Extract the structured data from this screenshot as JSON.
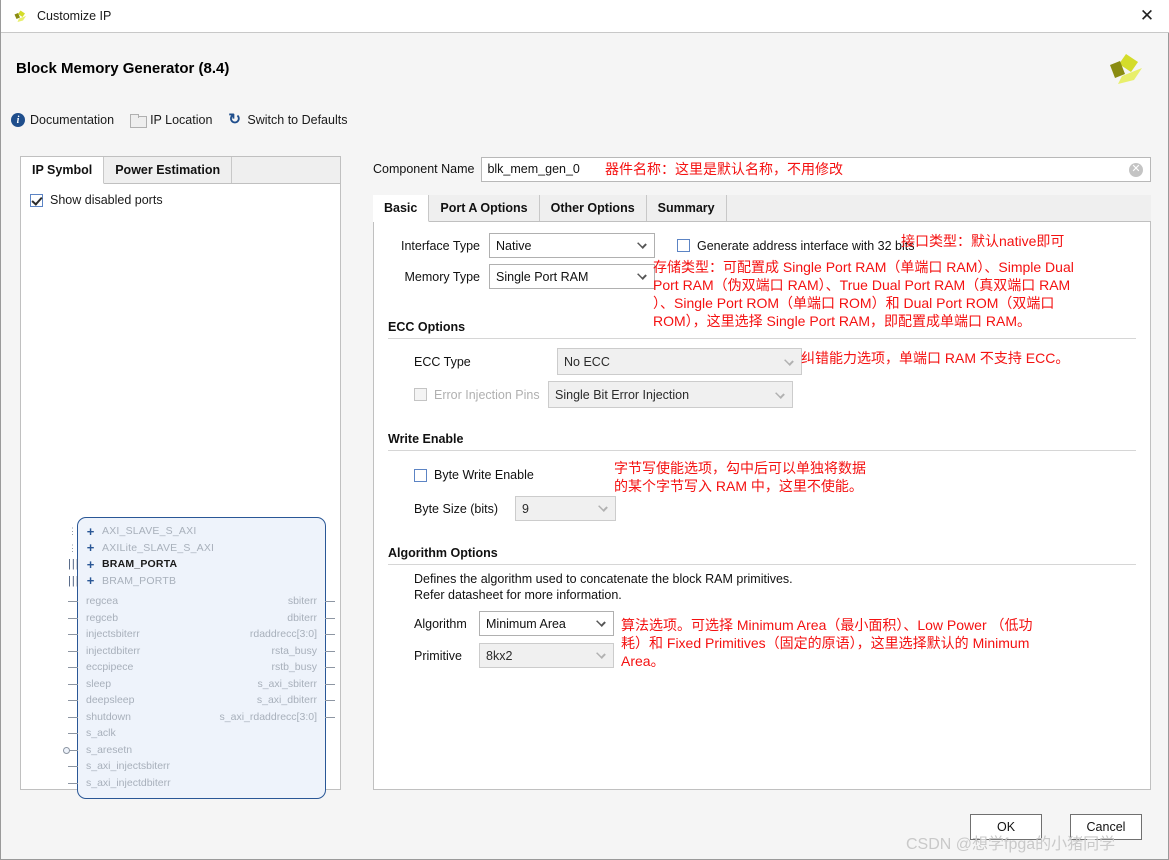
{
  "window": {
    "title": "Customize IP",
    "close_label": "✕",
    "logo_icon": "xilinx-logo"
  },
  "header": {
    "title": "Block Memory Generator (8.4)"
  },
  "toolbar": {
    "items": [
      {
        "label": "Documentation",
        "icon": "info-icon"
      },
      {
        "label": "IP Location",
        "icon": "folder-icon"
      },
      {
        "label": "Switch to Defaults",
        "icon": "refresh-icon"
      }
    ]
  },
  "left_panel": {
    "tabs": [
      {
        "label": "IP Symbol",
        "active": true
      },
      {
        "label": "Power Estimation",
        "active": false
      }
    ],
    "show_disabled_ports": {
      "label": "Show disabled ports",
      "checked": true
    },
    "symbol": {
      "buses": [
        {
          "label": "AXI_SLAVE_S_AXI",
          "enabled": false,
          "stub": "dotted"
        },
        {
          "label": "AXILite_SLAVE_S_AXI",
          "enabled": false,
          "stub": "dotted"
        },
        {
          "label": "BRAM_PORTA",
          "enabled": true,
          "stub": "solid"
        },
        {
          "label": "BRAM_PORTB",
          "enabled": false,
          "stub": "solid"
        }
      ],
      "pins": [
        {
          "left": "regcea",
          "right": "sbiterr"
        },
        {
          "left": "regceb",
          "right": "dbiterr"
        },
        {
          "left": "injectsbiterr",
          "right": "rdaddrecc[3:0]"
        },
        {
          "left": "injectdbiterr",
          "right": "rsta_busy"
        },
        {
          "left": "eccpipece",
          "right": "rstb_busy"
        },
        {
          "left": "sleep",
          "right": "s_axi_sbiterr"
        },
        {
          "left": "deepsleep",
          "right": "s_axi_dbiterr"
        },
        {
          "left": "shutdown",
          "right": "s_axi_rdaddrecc[3:0]"
        },
        {
          "left": "s_aclk",
          "right": ""
        },
        {
          "left": "s_aresetn",
          "right": ""
        },
        {
          "left": "s_axi_injectsbiterr",
          "right": ""
        },
        {
          "left": "s_axi_injectdbiterr",
          "right": ""
        }
      ]
    }
  },
  "right_panel": {
    "component_name": {
      "label": "Component Name",
      "value": "blk_mem_gen_0",
      "clear_icon": "clear-icon"
    },
    "tabs": [
      {
        "label": "Basic",
        "active": true
      },
      {
        "label": "Port A Options",
        "active": false
      },
      {
        "label": "Other Options",
        "active": false
      },
      {
        "label": "Summary",
        "active": false
      }
    ],
    "basic": {
      "interface_type": {
        "label": "Interface Type",
        "value": "Native"
      },
      "memory_type": {
        "label": "Memory Type",
        "value": "Single Port RAM"
      },
      "generate_address_interface": {
        "label": "Generate address interface with 32 bits",
        "checked": false
      },
      "ecc_options": {
        "title": "ECC Options",
        "ecc_type": {
          "label": "ECC Type",
          "value": "No ECC",
          "disabled": true
        },
        "error_injection_pins": {
          "label": "Error Injection Pins",
          "checked": false,
          "disabled": true,
          "value": "Single Bit Error Injection"
        }
      },
      "write_enable": {
        "title": "Write Enable",
        "byte_write_enable": {
          "label": "Byte Write Enable",
          "checked": false
        },
        "byte_size": {
          "label": "Byte Size (bits)",
          "value": "9",
          "disabled": true
        }
      },
      "algorithm_options": {
        "title": "Algorithm Options",
        "description_line1": "Defines the algorithm used to concatenate the block RAM primitives.",
        "description_line2": "Refer datasheet for more information.",
        "algorithm": {
          "label": "Algorithm",
          "value": "Minimum Area"
        },
        "primitive": {
          "label": "Primitive",
          "value": "8kx2",
          "disabled": true
        }
      }
    }
  },
  "annotations": {
    "component_name": "器件名称：这里是默认名称，不用修改",
    "interface_type": "接口类型：默认native即可",
    "memory_type": "存储类型：可配置成 Single Port RAM（单端口 RAM）、Simple Dual\nPort RAM（伪双端口 RAM）、True Dual Port RAM（真双端口 RAM\n）、Single Port ROM（单端口 ROM）和 Dual Port ROM（双端口\nROM），这里选择 Single Port RAM，即配置成单端口 RAM。",
    "ecc_type": "纠错能力选项，单端口 RAM 不支持 ECC。",
    "byte_write_enable": "字节写使能选项，勾中后可以单独将数据\n的某个字节写入 RAM 中，这里不使能。",
    "algorithm": "算法选项。可选择 Minimum Area（最小面积）、Low Power （低功\n耗）和 Fixed Primitives（固定的原语），这里选择默认的 Minimum\nArea。"
  },
  "footer": {
    "ok_label": "OK",
    "cancel_label": "Cancel"
  },
  "watermark": "CSDN @想学fpga的小猪同学"
}
